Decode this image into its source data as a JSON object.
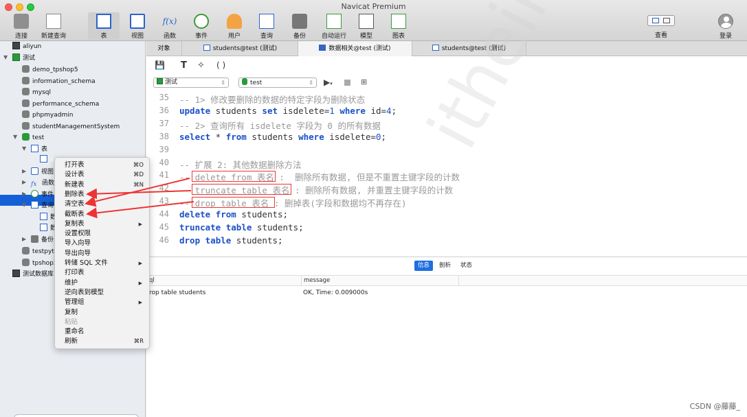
{
  "window": {
    "title": "Navicat Premium"
  },
  "toolbar": [
    {
      "id": "connect",
      "label": "连接",
      "icon": "plug-icon"
    },
    {
      "id": "new-query",
      "label": "新建查询",
      "icon": "new-query-icon"
    },
    {
      "id": "table",
      "label": "表",
      "icon": "table-icon",
      "active": true
    },
    {
      "id": "view",
      "label": "视图",
      "icon": "view-icon"
    },
    {
      "id": "function",
      "label": "函数",
      "icon": "function-icon"
    },
    {
      "id": "event",
      "label": "事件",
      "icon": "clock-icon"
    },
    {
      "id": "user",
      "label": "用户",
      "icon": "user-icon"
    },
    {
      "id": "query",
      "label": "查询",
      "icon": "query-icon"
    },
    {
      "id": "backup",
      "label": "备份",
      "icon": "backup-icon"
    },
    {
      "id": "auto-run",
      "label": "自动运行",
      "icon": "auto-run-icon"
    },
    {
      "id": "model",
      "label": "模型",
      "icon": "model-icon"
    },
    {
      "id": "chart",
      "label": "图表",
      "icon": "chart-icon"
    }
  ],
  "toolbar_right": {
    "view_label": "查看",
    "login_label": "登录"
  },
  "sidebar": {
    "nodes": [
      "aliyun",
      "测试",
      "demo_tpshop5",
      "information_schema",
      "mysql",
      "performance_schema",
      "phpmyadmin",
      "studentManagementSystem",
      "test",
      "表",
      "s",
      "视图",
      "函数",
      "事件",
      "查询",
      "数",
      "数",
      "备份",
      "testpyth",
      "tpshop2",
      "测试数据库"
    ]
  },
  "tabs": [
    "对象",
    "students@test (测试)",
    "数据相关@test (测试)",
    "students@test (测试)"
  ],
  "editor": {
    "connection": "测试",
    "database": "test",
    "first_line": 35,
    "lines": [
      [
        {
          "t": "-- 1> 修改要删除的数据的特定字段为删除状态",
          "c": "cm"
        }
      ],
      [
        {
          "t": "update",
          "c": "kw"
        },
        {
          "t": " students ",
          "c": ""
        },
        {
          "t": "set",
          "c": "kw"
        },
        {
          "t": " isdelete=",
          "c": ""
        },
        {
          "t": "1",
          "c": "nm"
        },
        {
          "t": " ",
          "c": ""
        },
        {
          "t": "where",
          "c": "kw"
        },
        {
          "t": " id=",
          "c": ""
        },
        {
          "t": "4",
          "c": "nm"
        },
        {
          "t": ";",
          "c": ""
        }
      ],
      [
        {
          "t": "-- 2> 查询所有 isdelete 字段为 0 的所有数据",
          "c": "cm"
        }
      ],
      [
        {
          "t": "select",
          "c": "kw"
        },
        {
          "t": " * ",
          "c": ""
        },
        {
          "t": "from",
          "c": "kw"
        },
        {
          "t": " students ",
          "c": ""
        },
        {
          "t": "where",
          "c": "kw"
        },
        {
          "t": " isdelete=",
          "c": ""
        },
        {
          "t": "0",
          "c": "nm"
        },
        {
          "t": ";",
          "c": ""
        }
      ],
      [],
      [
        {
          "t": "-- 扩展 2: 其他数据删除方法",
          "c": "cm"
        }
      ],
      [
        {
          "t": "-- delete from 表名 :  删除所有数据, 但是不重置主键字段的计数",
          "c": "cm"
        }
      ],
      [
        {
          "t": "-- truncate table 表名 : 删除所有数据, 并重置主键字段的计数",
          "c": "cm"
        }
      ],
      [
        {
          "t": "-- drop table 表名 : 删掉表(字段和数据均不再存在)",
          "c": "cm"
        }
      ],
      [
        {
          "t": "delete",
          "c": "kw"
        },
        {
          "t": " ",
          "c": ""
        },
        {
          "t": "from",
          "c": "kw"
        },
        {
          "t": " students;",
          "c": ""
        }
      ],
      [
        {
          "t": "truncate",
          "c": "kw"
        },
        {
          "t": " ",
          "c": ""
        },
        {
          "t": "table",
          "c": "kw"
        },
        {
          "t": " students;",
          "c": ""
        }
      ],
      [
        {
          "t": "drop",
          "c": "kw"
        },
        {
          "t": " ",
          "c": ""
        },
        {
          "t": "table",
          "c": "kw"
        },
        {
          "t": " students;",
          "c": ""
        }
      ]
    ]
  },
  "results": {
    "tabs": [
      "信息",
      "剖析",
      "状态"
    ],
    "columns": [
      "ql",
      "message"
    ],
    "row": [
      "rop table students",
      "OK, Time: 0.009000s"
    ]
  },
  "context_menu": [
    {
      "label": "打开表",
      "shortcut": "⌘O"
    },
    {
      "label": "设计表",
      "shortcut": "⌘D"
    },
    {
      "label": "新建表",
      "shortcut": "⌘N"
    },
    {
      "label": "删除表"
    },
    {
      "label": "清空表"
    },
    {
      "label": "截断表"
    },
    {
      "label": "复制表",
      "submenu": true
    },
    {
      "label": "设置权限"
    },
    {
      "label": "导入向导"
    },
    {
      "label": "导出向导"
    },
    {
      "label": "转储 SQL 文件",
      "submenu": true
    },
    {
      "label": "打印表"
    },
    {
      "label": "维护",
      "submenu": true
    },
    {
      "label": "逆向表到模型"
    },
    {
      "label": "管理组",
      "submenu": true
    },
    {
      "label": "复制"
    },
    {
      "label": "粘贴",
      "disabled": true
    },
    {
      "label": "重命名"
    },
    {
      "label": "刷新",
      "shortcut": "⌘R"
    }
  ],
  "watermark": "itheima.com",
  "credit": "CSDN @藤藤_",
  "colors": {
    "accent": "#1560d9",
    "keyword": "#1a4fc9",
    "comment": "#999999",
    "annotation": "#e33333"
  }
}
